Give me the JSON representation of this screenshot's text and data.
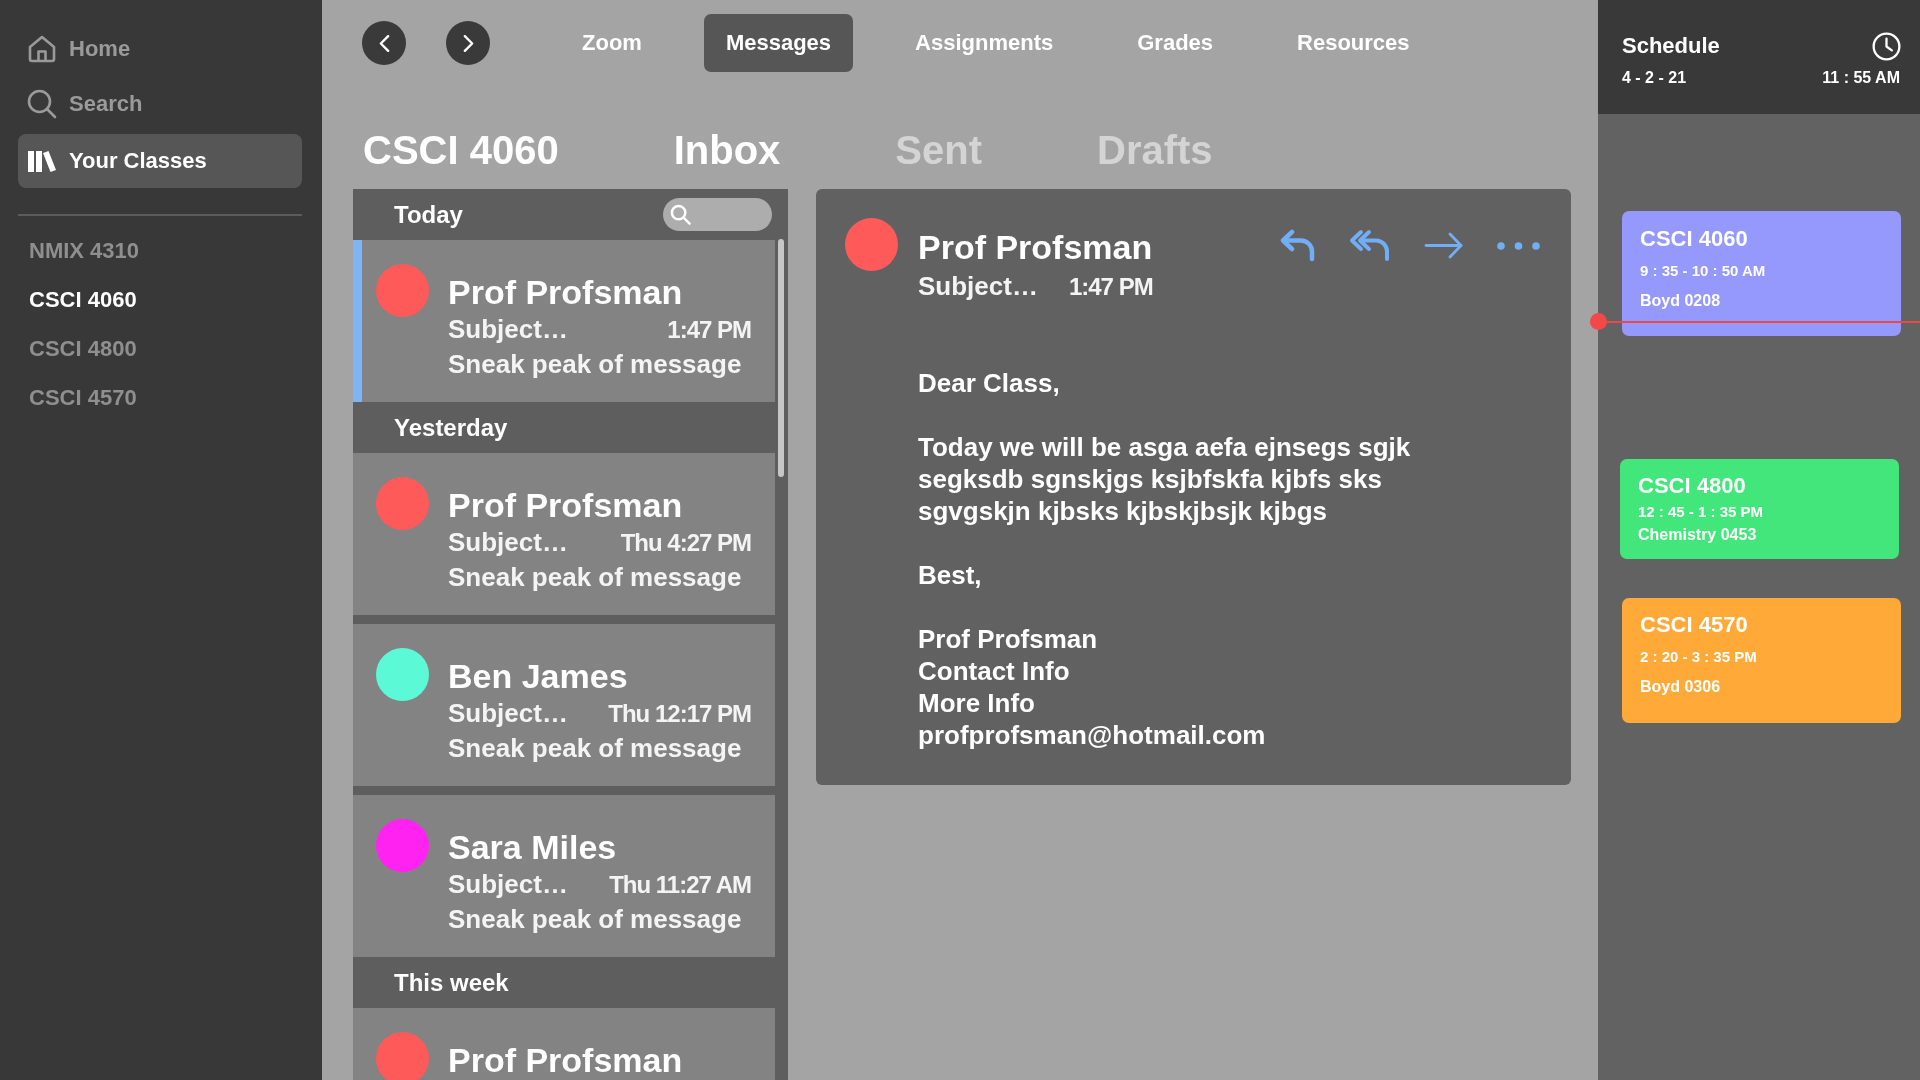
{
  "sidebar": {
    "nav": [
      {
        "label": "Home",
        "kind": "home",
        "selected": false
      },
      {
        "label": "Search",
        "kind": "search",
        "selected": false
      },
      {
        "label": "Your Classes",
        "kind": "library",
        "selected": true
      }
    ],
    "classes": [
      {
        "label": "NMIX 4310",
        "selected": false
      },
      {
        "label": "CSCI 4060",
        "selected": true
      },
      {
        "label": "CSCI 4800",
        "selected": false
      },
      {
        "label": "CSCI 4570",
        "selected": false
      }
    ]
  },
  "toolbar": {
    "tabs": [
      {
        "label": "Zoom",
        "selected": false
      },
      {
        "label": "Messages",
        "selected": true
      },
      {
        "label": "Assignments",
        "selected": false
      },
      {
        "label": "Grades",
        "selected": false
      },
      {
        "label": "Resources",
        "selected": false
      }
    ]
  },
  "header": {
    "course": "CSCI 4060",
    "folders": [
      {
        "label": "Inbox",
        "selected": true
      },
      {
        "label": "Sent",
        "selected": false
      },
      {
        "label": "Drafts",
        "selected": false
      }
    ]
  },
  "message_list": {
    "groups": [
      {
        "label": "Today",
        "messages": [
          {
            "sender": "Prof Profsman",
            "color": "#ff5a5a",
            "subject": "Subject…",
            "time": "1:47 PM",
            "preview": "Sneak peak of message",
            "selected": true
          }
        ]
      },
      {
        "label": "Yesterday",
        "messages": [
          {
            "sender": "Prof Profsman",
            "color": "#ff5a5a",
            "subject": "Subject…",
            "time": "Thu 4:27 PM",
            "preview": "Sneak peak of message",
            "selected": false
          },
          {
            "sender": "Ben James",
            "color": "#5cf9d6",
            "subject": "Subject…",
            "time": "Thu 12:17 PM",
            "preview": "Sneak peak of message",
            "selected": false
          },
          {
            "sender": "Sara Miles",
            "color": "#ff22f0",
            "subject": "Subject…",
            "time": "Thu 11:27 AM",
            "preview": "Sneak peak of message",
            "selected": false
          }
        ]
      },
      {
        "label": "This week",
        "messages": [
          {
            "sender": "Prof Profsman",
            "color": "#ff5a5a",
            "selected": false
          }
        ]
      }
    ]
  },
  "message": {
    "sender": "Prof Profsman",
    "color": "#ff5a5a",
    "subject": "Subject…",
    "time": "1:47 PM",
    "body": [
      [
        "Dear Class,"
      ],
      [
        "Today we will be asga aefa ejnsegs sgjk segksdb sgnskjgs ksjbfskfa kjbfs sks sgvgskjn kjbsks kjbskjbsjk kjbgs"
      ],
      [
        "Best,"
      ],
      [
        "Prof Profsman",
        "Contact Info",
        "More Info",
        "profprofsman@hotmail.com"
      ]
    ]
  },
  "schedule": {
    "title": "Schedule",
    "date": "4 - 2 - 21",
    "time": "11 : 55 AM",
    "events": [
      {
        "course": "CSCI 4060",
        "time": "9 : 35 - 10 : 50 AM",
        "room": "Boyd 0208",
        "color": "#9599fe"
      },
      {
        "course": "CSCI 4800",
        "time": "12 : 45 - 1 : 35 PM",
        "room": "Chemistry 0453",
        "color": "#43e67a"
      },
      {
        "course": "CSCI 4570",
        "time": "2 : 20 - 3 : 35 PM",
        "room": "Boyd 0306",
        "color": "#ffaa38"
      }
    ]
  }
}
